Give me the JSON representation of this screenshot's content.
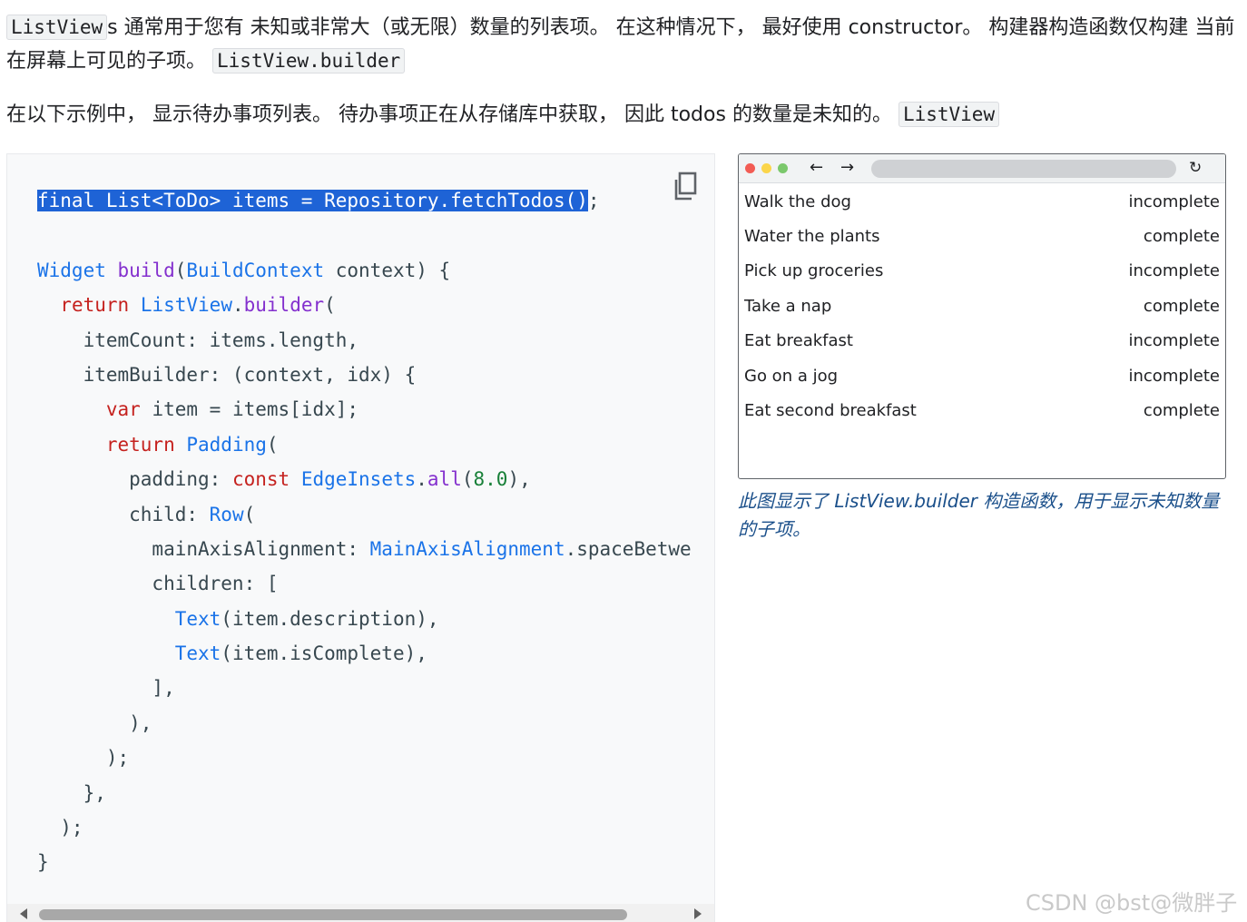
{
  "intro": {
    "p1_code_1": "ListView",
    "p1_text_1": "s 通常用于您有 未知或非常大（或无限）数量的列表项。 在这种情况下， 最好使用 constructor。 构建器构造函数仅构建 当前在屏幕上可见的子项。",
    "p1_code_2": "ListView.builder",
    "p2_text": "在以下示例中， 显示待办事项列表。 待办事项正在从存储库中获取， 因此 todos 的数量是未知的。",
    "p2_code": "ListView"
  },
  "code": {
    "lines": [
      [
        {
          "t": "final List<ToDo> items = Repository.fetchTodos()",
          "c": "sel"
        },
        {
          "t": ";",
          "c": ""
        }
      ],
      [],
      [
        {
          "t": "Widget",
          "c": "ty"
        },
        {
          "t": " ",
          "c": ""
        },
        {
          "t": "build",
          "c": "fn"
        },
        {
          "t": "(",
          "c": ""
        },
        {
          "t": "BuildContext",
          "c": "ty"
        },
        {
          "t": " context) {",
          "c": ""
        }
      ],
      [
        {
          "t": "  ",
          "c": ""
        },
        {
          "t": "return",
          "c": "kw"
        },
        {
          "t": " ",
          "c": ""
        },
        {
          "t": "ListView",
          "c": "ty"
        },
        {
          "t": ".",
          "c": ""
        },
        {
          "t": "builder",
          "c": "fn"
        },
        {
          "t": "(",
          "c": ""
        }
      ],
      [
        {
          "t": "    itemCount: items.length,",
          "c": ""
        }
      ],
      [
        {
          "t": "    itemBuilder: (context, idx) {",
          "c": ""
        }
      ],
      [
        {
          "t": "      ",
          "c": ""
        },
        {
          "t": "var",
          "c": "kw"
        },
        {
          "t": " item = items[idx];",
          "c": ""
        }
      ],
      [
        {
          "t": "      ",
          "c": ""
        },
        {
          "t": "return",
          "c": "kw"
        },
        {
          "t": " ",
          "c": ""
        },
        {
          "t": "Padding",
          "c": "ty"
        },
        {
          "t": "(",
          "c": ""
        }
      ],
      [
        {
          "t": "        padding: ",
          "c": ""
        },
        {
          "t": "const",
          "c": "kw"
        },
        {
          "t": " ",
          "c": ""
        },
        {
          "t": "EdgeInsets",
          "c": "ty"
        },
        {
          "t": ".",
          "c": ""
        },
        {
          "t": "all",
          "c": "fn"
        },
        {
          "t": "(",
          "c": ""
        },
        {
          "t": "8.0",
          "c": "nm"
        },
        {
          "t": "),",
          "c": ""
        }
      ],
      [
        {
          "t": "        child: ",
          "c": ""
        },
        {
          "t": "Row",
          "c": "ty"
        },
        {
          "t": "(",
          "c": ""
        }
      ],
      [
        {
          "t": "          mainAxisAlignment: ",
          "c": ""
        },
        {
          "t": "MainAxisAlignment",
          "c": "ty"
        },
        {
          "t": ".spaceBetwe",
          "c": ""
        }
      ],
      [
        {
          "t": "          children: [",
          "c": ""
        }
      ],
      [
        {
          "t": "            ",
          "c": ""
        },
        {
          "t": "Text",
          "c": "ty"
        },
        {
          "t": "(item.description),",
          "c": ""
        }
      ],
      [
        {
          "t": "            ",
          "c": ""
        },
        {
          "t": "Text",
          "c": "ty"
        },
        {
          "t": "(item.isComplete),",
          "c": ""
        }
      ],
      [
        {
          "t": "          ],",
          "c": ""
        }
      ],
      [
        {
          "t": "        ),",
          "c": ""
        }
      ],
      [
        {
          "t": "      );",
          "c": ""
        }
      ],
      [
        {
          "t": "    },",
          "c": ""
        }
      ],
      [
        {
          "t": "  );",
          "c": ""
        }
      ],
      [
        {
          "t": "}",
          "c": ""
        }
      ]
    ]
  },
  "browser": {
    "back_glyph": "←",
    "forward_glyph": "→",
    "reload_glyph": "↻",
    "items": [
      {
        "description": "Walk the dog",
        "status": "incomplete"
      },
      {
        "description": "Water the plants",
        "status": "complete"
      },
      {
        "description": "Pick up groceries",
        "status": "incomplete"
      },
      {
        "description": "Take a nap",
        "status": "complete"
      },
      {
        "description": "Eat breakfast",
        "status": "incomplete"
      },
      {
        "description": "Go on a jog",
        "status": "incomplete"
      },
      {
        "description": "Eat second breakfast",
        "status": "complete"
      }
    ]
  },
  "caption": "此图显示了 ListView.builder 构造函数，用于显示未知数量的子项。",
  "watermark": "CSDN @bst@微胖子",
  "icons": {
    "copy": "copy-icon",
    "back": "arrow-left-icon",
    "forward": "arrow-right-icon",
    "reload": "reload-icon"
  },
  "colors": {
    "selection": "#1e63d6",
    "keyword": "#c5221f",
    "type": "#1a73e8",
    "function": "#8430ce",
    "number": "#188038"
  }
}
